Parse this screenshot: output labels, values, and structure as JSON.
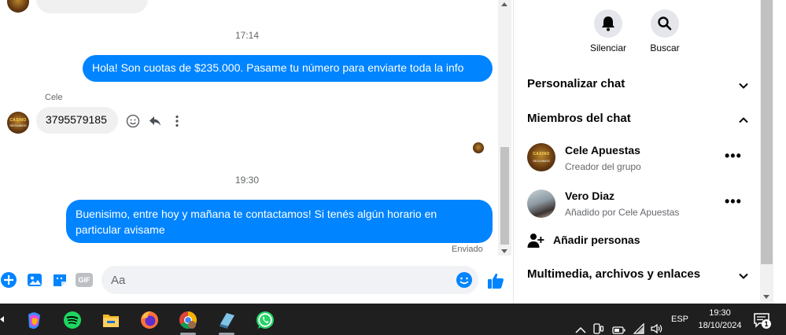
{
  "chat": {
    "messages": [
      {
        "time": "17:14"
      },
      {
        "text": "Hola! Son cuotas de $235.000. Pasame tu número para enviarte toda la info"
      },
      {
        "sender": "Cele",
        "text": "3795579185"
      },
      {
        "time": "19:30"
      },
      {
        "text": "Buenisimo, entre hoy y mañana te contactamos! Si tenés algún horario en particular avisame",
        "status": "Enviado"
      }
    ],
    "avatar_logo": {
      "line1": "CASINO",
      "line2": "SEGUIMOS"
    },
    "composer": {
      "placeholder": "Aa"
    },
    "icons": [
      "add-icon",
      "image-icon",
      "sticker-icon",
      "gif-icon",
      "emoji-icon",
      "like-icon",
      "smiley-react-icon",
      "reply-icon",
      "more-vertical-icon"
    ],
    "gif_label": "GIF"
  },
  "panel": {
    "actions": [
      {
        "label": "Silenciar",
        "icon": "bell-icon"
      },
      {
        "label": "Buscar",
        "icon": "search-icon"
      }
    ],
    "sections": {
      "customize": "Personalizar chat",
      "members": "Miembros del chat",
      "media": "Multimedia, archivos y enlaces"
    },
    "members": [
      {
        "name": "Cele Apuestas",
        "role": "Creador del grupo"
      },
      {
        "name": "Vero Diaz",
        "role": "Añadido por Cele Apuestas"
      }
    ],
    "add_people": "Añadir personas"
  },
  "taskbar": {
    "apps": [
      "copilot-icon",
      "spotify-icon",
      "file-explorer-icon",
      "firefox-icon",
      "chrome-icon",
      "notepad-icon",
      "whatsapp-icon"
    ],
    "language": "ESP",
    "time": "19:30",
    "date": "18/10/2024",
    "notification_count": "1"
  },
  "colors": {
    "accent": "#0084ff",
    "bubble_in": "#f0f0f0",
    "taskbar": "#1f1f1f"
  }
}
